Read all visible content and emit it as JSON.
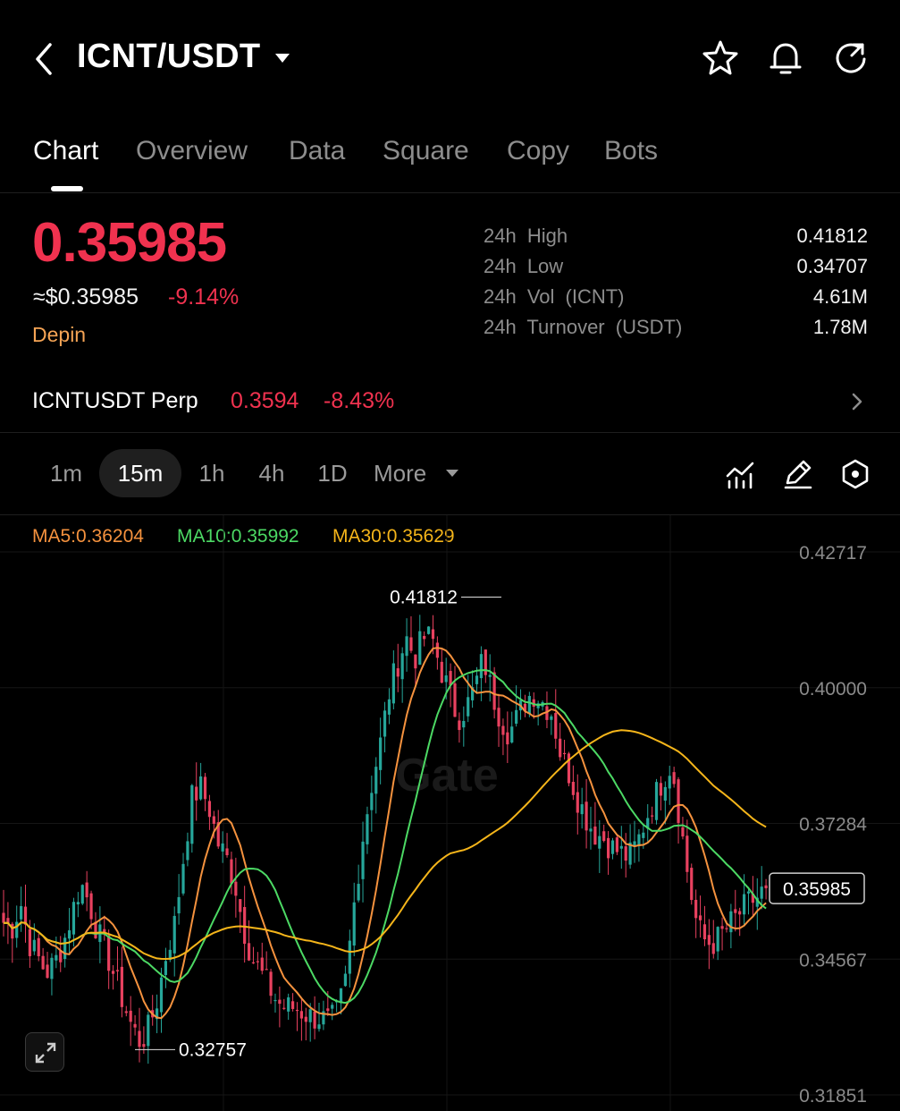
{
  "header": {
    "pair": "ICNT/USDT",
    "icons": [
      "back-icon",
      "caret-down-icon",
      "star-icon",
      "bell-icon",
      "share-icon"
    ]
  },
  "tabs": [
    "Chart",
    "Overview",
    "Data",
    "Square",
    "Copy",
    "Bots"
  ],
  "active_tab": "Chart",
  "ticker": {
    "price": "0.35985",
    "usd_price": "≈$0.35985",
    "change_pct": "-9.14%",
    "tag": "Depin",
    "price_color": "#f0324f",
    "tag_color": "#f5a455"
  },
  "stats": [
    {
      "label": "24h High",
      "value": "0.41812"
    },
    {
      "label": "24h Low",
      "value": "0.34707"
    },
    {
      "label": "24h Vol (ICNT)",
      "value": "4.61M"
    },
    {
      "label": "24h Turnover (USDT)",
      "value": "1.78M"
    }
  ],
  "perp": {
    "name": "ICNTUSDT Perp",
    "price": "0.3594",
    "change_pct": "-8.43%"
  },
  "intervals": [
    "1m",
    "15m",
    "1h",
    "4h",
    "1D"
  ],
  "active_interval": "15m",
  "more_label": "More",
  "tool_icons": [
    "indicator-icon",
    "draw-pen-icon",
    "settings-hex-icon",
    "expand-icon"
  ],
  "ma": [
    {
      "label": "MA5:0.36204",
      "color": "#f5923e"
    },
    {
      "label": "MA10:0.35992",
      "color": "#4cd964"
    },
    {
      "label": "MA30:0.35629",
      "color": "#f5b51a"
    }
  ],
  "watermark": "Gate",
  "chart_data": {
    "type": "candlestick",
    "interval": "15m",
    "y_ticks": [
      "0.42717",
      "0.40000",
      "0.37284",
      "0.34567",
      "0.31851"
    ],
    "ylim": [
      0.31851,
      0.42717
    ],
    "last_price_label": "0.35985",
    "last_price": 0.35985,
    "high_marker": {
      "label": "0.41812",
      "value": 0.41812
    },
    "low_marker": {
      "label": "0.32757",
      "value": 0.32757
    },
    "up_color": "#26a69a",
    "down_color": "#e8415f",
    "close_path": [
      0.353,
      0.352,
      0.357,
      0.349,
      0.346,
      0.343,
      0.345,
      0.349,
      0.355,
      0.361,
      0.357,
      0.351,
      0.347,
      0.342,
      0.337,
      0.332,
      0.329,
      0.332,
      0.338,
      0.347,
      0.353,
      0.366,
      0.378,
      0.38,
      0.376,
      0.369,
      0.366,
      0.361,
      0.352,
      0.346,
      0.343,
      0.34,
      0.337,
      0.336,
      0.336,
      0.335,
      0.334,
      0.334,
      0.333,
      0.335,
      0.342,
      0.358,
      0.371,
      0.381,
      0.389,
      0.399,
      0.405,
      0.41,
      0.406,
      0.41,
      0.41,
      0.404,
      0.399,
      0.394,
      0.396,
      0.4,
      0.406,
      0.399,
      0.394,
      0.391,
      0.394,
      0.398,
      0.399,
      0.397,
      0.395,
      0.387,
      0.383,
      0.378,
      0.374,
      0.371,
      0.37,
      0.368,
      0.367,
      0.366,
      0.369,
      0.374,
      0.378,
      0.382,
      0.385,
      0.373,
      0.361,
      0.352,
      0.349,
      0.349,
      0.351,
      0.353,
      0.355,
      0.357,
      0.358,
      0.36
    ]
  }
}
